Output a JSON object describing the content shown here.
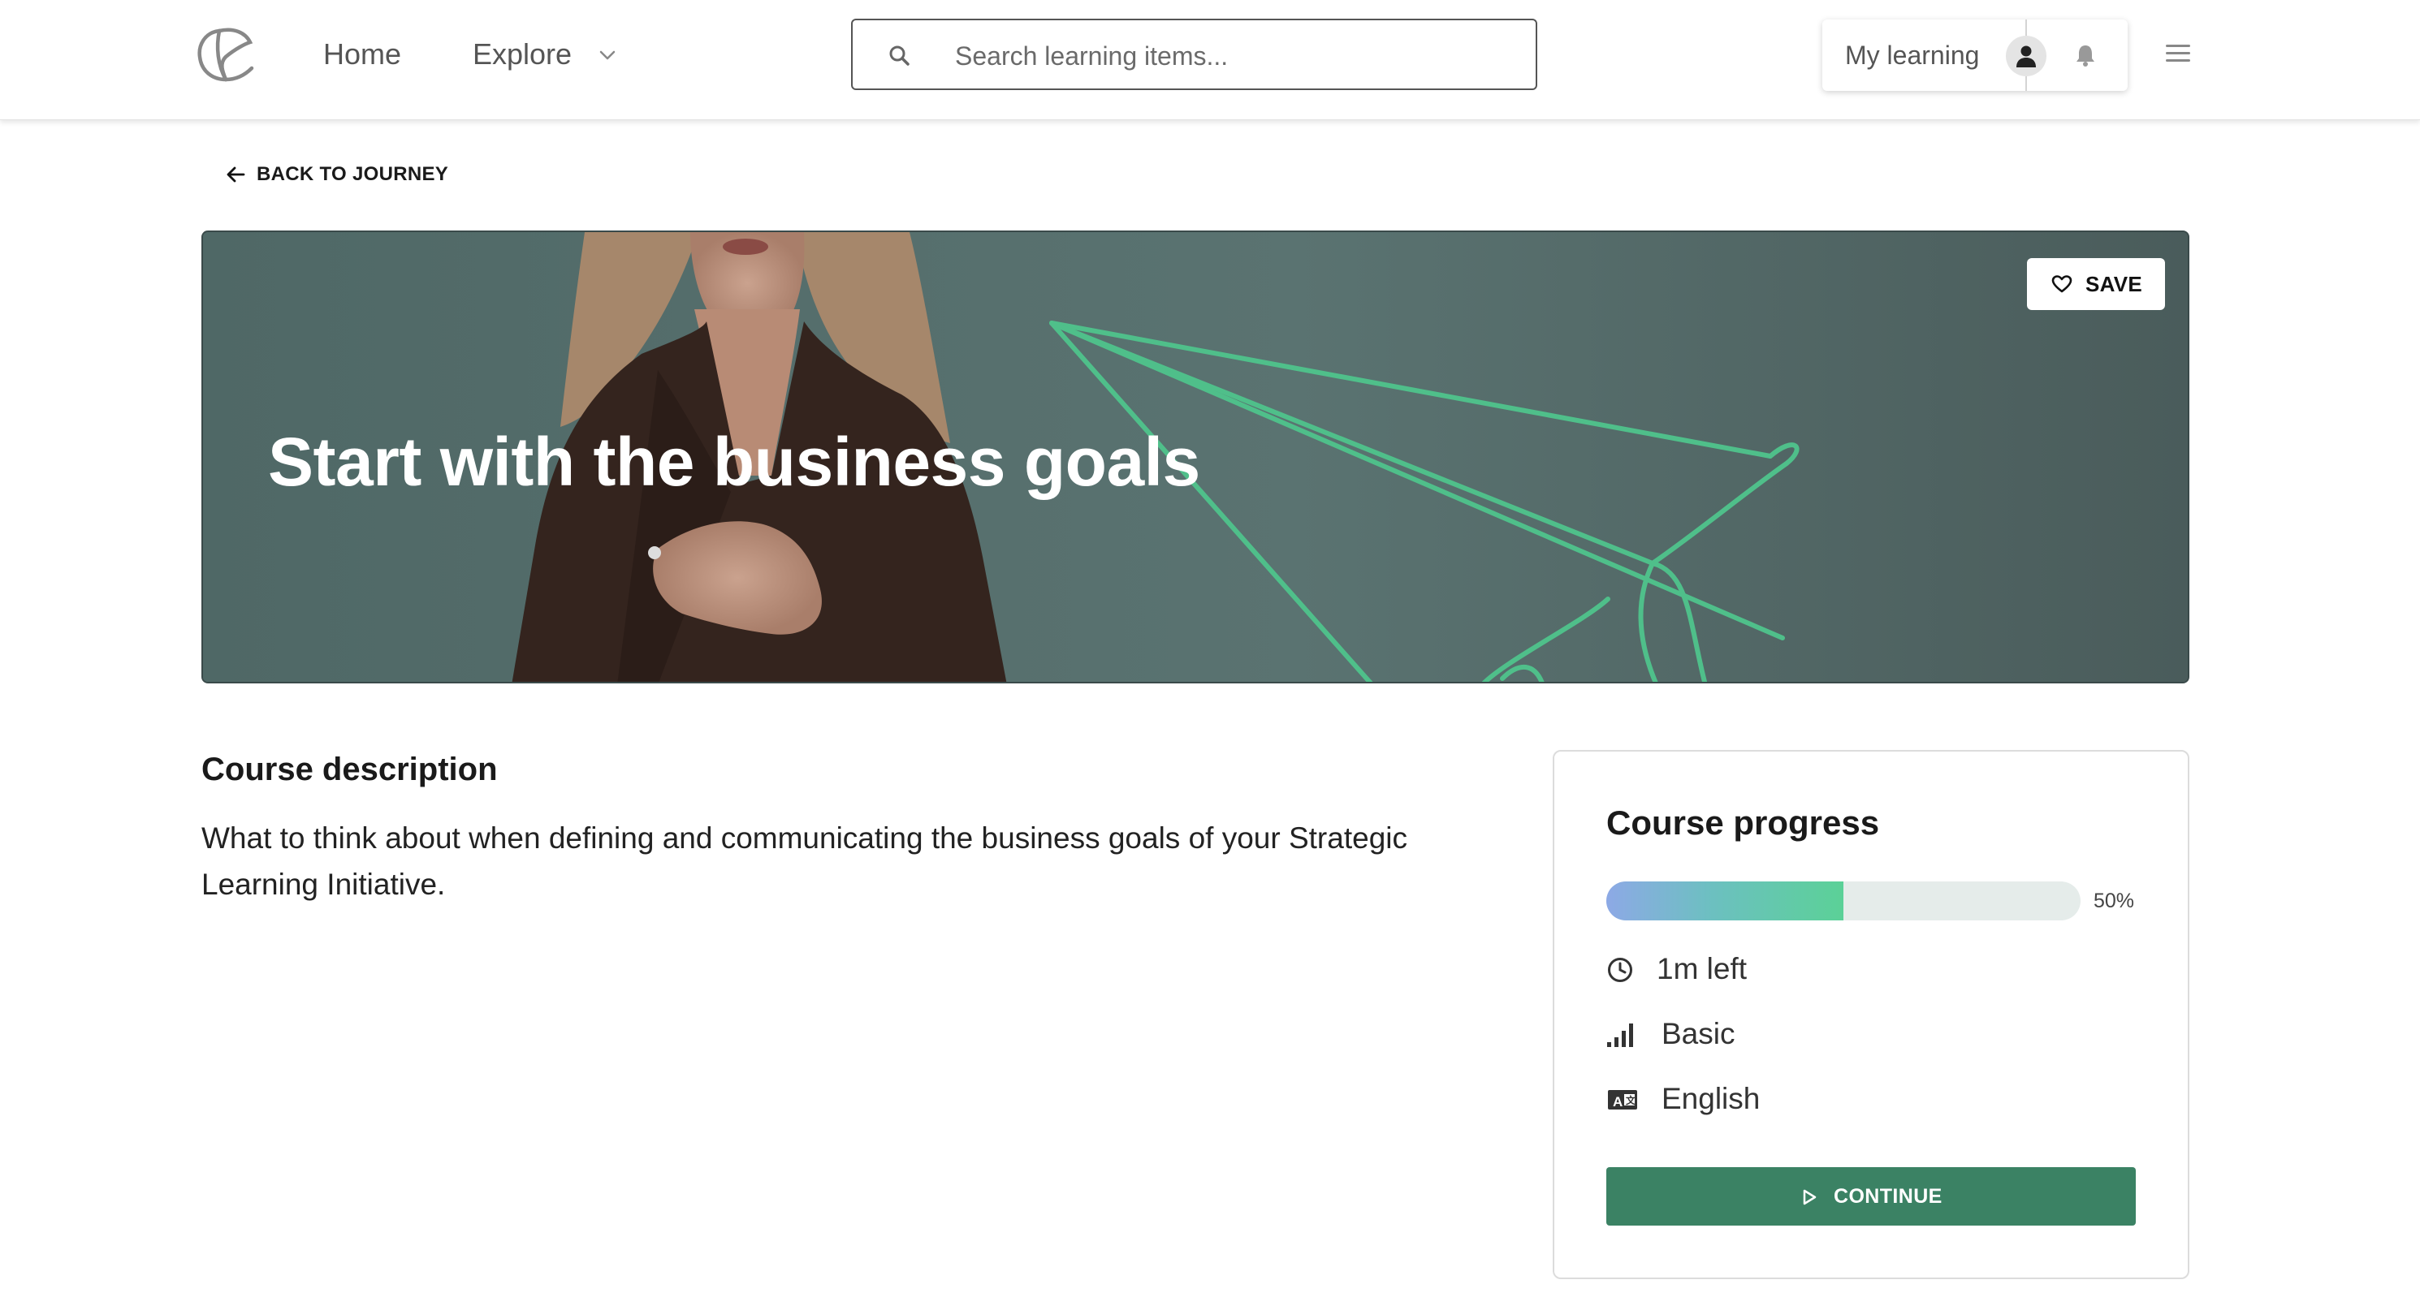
{
  "header": {
    "nav_home": "Home",
    "nav_explore": "Explore",
    "search_placeholder": "Search learning items...",
    "my_learning": "My learning"
  },
  "back_link": "BACK TO JOURNEY",
  "hero": {
    "title": "Start with the business goals",
    "save_label": "SAVE"
  },
  "description": {
    "title": "Course description",
    "text": "What to think about when defining and communicating the business goals of your Strategic Learning Initiative."
  },
  "progress": {
    "title": "Course progress",
    "percent": 50,
    "percent_label": "50%",
    "time_left": "1m left",
    "level": "Basic",
    "language": "English",
    "continue_label": "CONTINUE"
  },
  "colors": {
    "accent": "#3b8264",
    "hero_bg": "#516a68",
    "plane_line": "#4fbf8a"
  },
  "icons": [
    "logo-icon",
    "chevron-down-icon",
    "search-icon",
    "user-icon",
    "bell-icon",
    "menu-icon",
    "arrow-left-icon",
    "heart-icon",
    "clock-icon",
    "level-bars-icon",
    "language-icon",
    "play-icon"
  ]
}
